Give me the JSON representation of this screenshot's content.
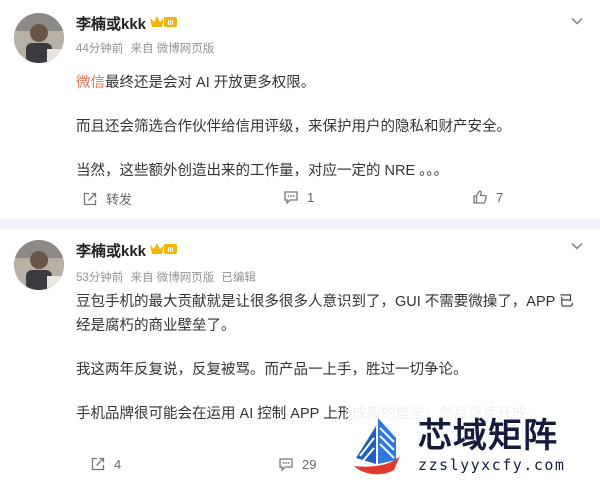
{
  "posts": [
    {
      "username": "李楠或kkk",
      "vip_badge": "III",
      "time": "44分钟前",
      "source": "来自 微博网页版",
      "edited": "",
      "content": {
        "p1_highlight": "微信",
        "p1_rest": "最终还是会对 AI 开放更多权限。",
        "p2": "而且还会筛选合作伙伴给信用评级，来保护用户的隐私和财产安全。",
        "p3": "当然，这些额外创造出来的工作量，对应一定的 NRE 。。。"
      },
      "actions": {
        "repost": "转发",
        "comment": "1",
        "like": "7"
      }
    },
    {
      "username": "李楠或kkk",
      "vip_badge": "III",
      "time": "53分钟前",
      "source": "来自 微博网页版",
      "edited": "已编辑",
      "content": {
        "p1": "豆包手机的最大贡献就是让很多很多人意识到了，GUI 不需要微操了，APP 已经是腐朽的商业壁垒了。",
        "p2": "我这两年反复说，反复被骂。而产品一上手，胜过一切争论。",
        "p3": "手机品牌很可能会在运用 AI 控制 APP 上形成新的壁垒，然后逐步开放。"
      },
      "actions": {
        "repost": "4",
        "comment": "29",
        "like": ""
      }
    }
  ],
  "watermark": {
    "title": "芯域矩阵",
    "url": "zzslyyxcfy.com"
  },
  "colors": {
    "highlight": "#eb7350",
    "vip": "#f4b400",
    "watermark": "#141b3f"
  }
}
